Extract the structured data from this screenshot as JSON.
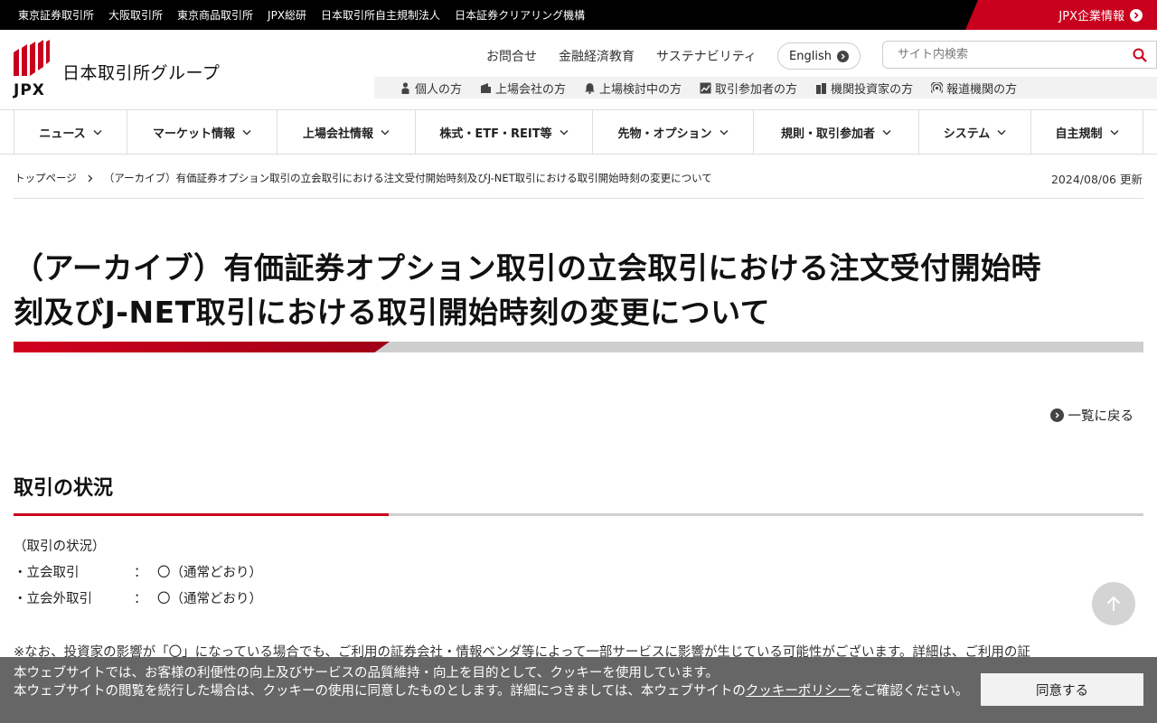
{
  "topbar": {
    "links": [
      "東京証券取引所",
      "大阪取引所",
      "東京商品取引所",
      "JPX総研",
      "日本取引所自主規制法人",
      "日本証券クリアリング機構"
    ],
    "corporate_label": "JPX企業情報",
    "accent_color": "#c8001e"
  },
  "header": {
    "logo_text": "日本取引所グループ",
    "logo_mark": "JPX",
    "utility_links": [
      "お問合せ",
      "金融経済教育",
      "サステナビリティ"
    ],
    "english_label": "English",
    "search_placeholder": "サイト内検索",
    "audience_links": [
      {
        "label": "個人の方",
        "icon": "person-icon"
      },
      {
        "label": "上場会社の方",
        "icon": "building-icon"
      },
      {
        "label": "上場検討中の方",
        "icon": "bell-icon"
      },
      {
        "label": "取引参加者の方",
        "icon": "chart-icon"
      },
      {
        "label": "機関投資家の方",
        "icon": "buildings-icon"
      },
      {
        "label": "報道機関の方",
        "icon": "broadcast-icon"
      }
    ]
  },
  "nav": {
    "items": [
      "ニュース",
      "マーケット情報",
      "上場会社情報",
      "株式・ETF・REIT等",
      "先物・オプション",
      "規則・取引参加者",
      "システム",
      "自主規制"
    ]
  },
  "breadcrumb": {
    "home": "トップページ",
    "current": "（アーカイブ）有価証券オプション取引の立会取引における注文受付開始時刻及びJ-NET取引における取引開始時刻の変更について"
  },
  "updated": "2024/08/06 更新",
  "page": {
    "title_line1": "（アーカイブ）有価証券オプション取引の立会取引における注文受付開始時",
    "title_line2": "刻及びJ-NET取引における取引開始時刻の変更について",
    "back_label": "一覧に戻る",
    "section_title": "取引の状況",
    "status_heading": "（取引の状況）",
    "status_rows": [
      {
        "label": "・立会取引",
        "colon": "：",
        "value": "〇（通常どおり）"
      },
      {
        "label": "・立会外取引",
        "colon": "：",
        "value": "〇（通常どおり）"
      }
    ],
    "note": "※なお、投資家の影響が「〇」になっている場合でも、ご利用の証券会社・情報ベンダ等によって一部サービスに影響が生じている可能性がございます。詳細は、ご利用の証"
  },
  "cookie": {
    "line1": "本ウェブサイトでは、お客様の利便性の向上及びサービスの品質維持・向上を目的として、クッキーを使用しています。",
    "line2_prefix": "本ウェブサイトの閲覧を続行した場合は、クッキーの使用に同意したものとします。詳細につきましては、本ウェブサイトの",
    "policy_link": "クッキーポリシー",
    "line2_suffix": "をご確認ください。",
    "agree_label": "同意する"
  }
}
